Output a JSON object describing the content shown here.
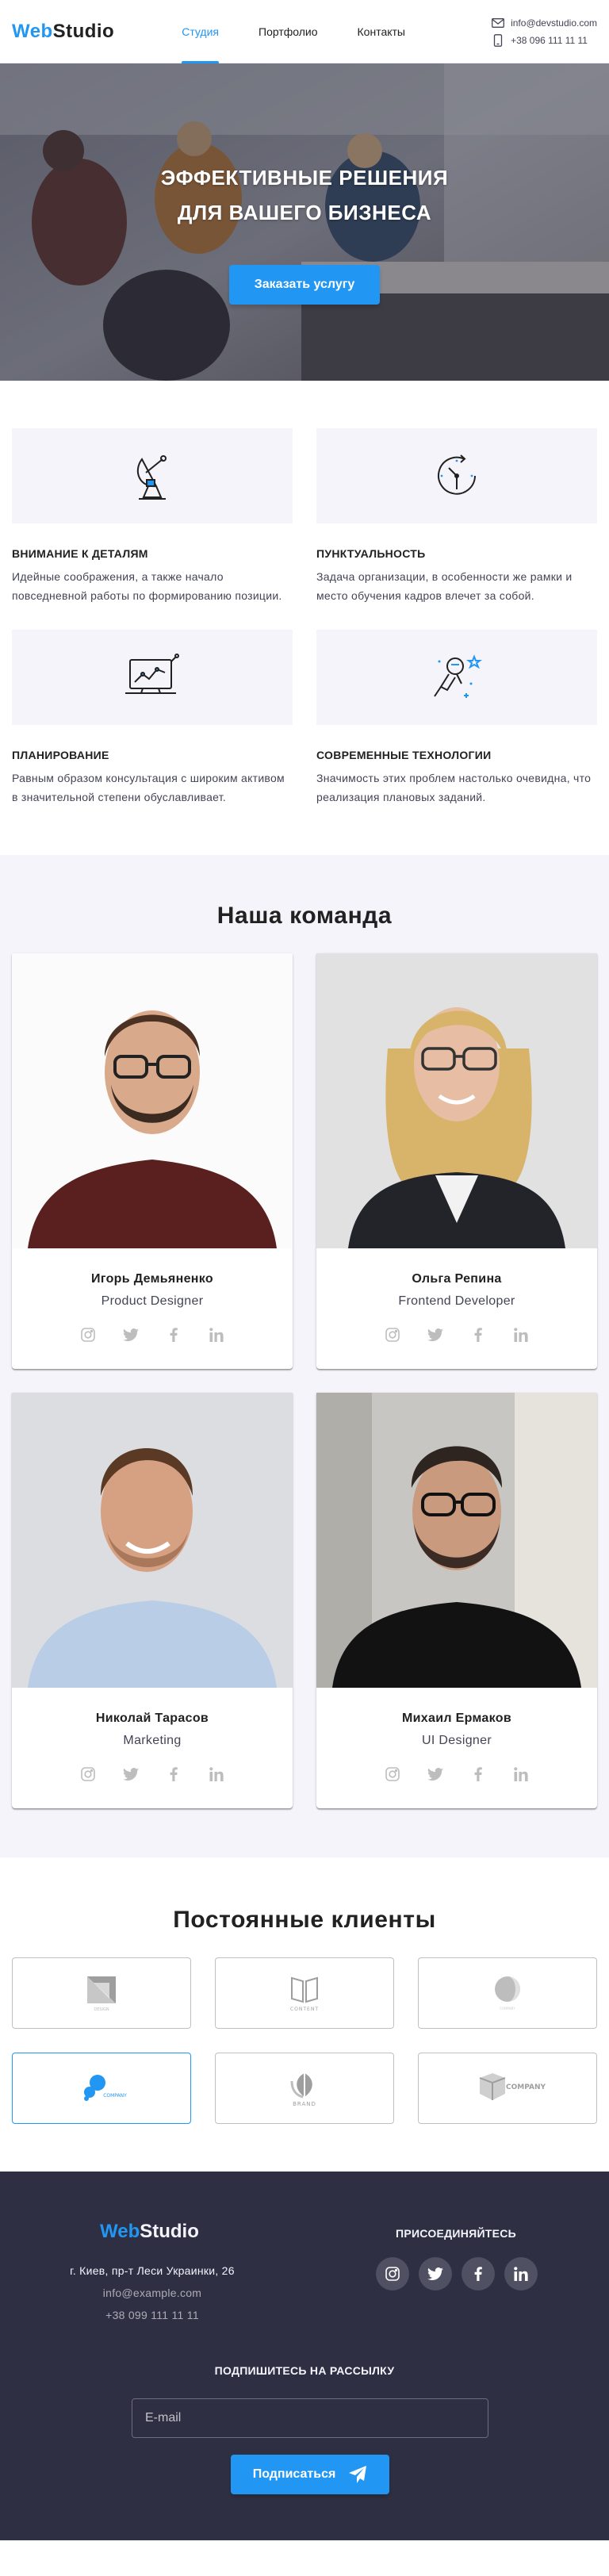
{
  "header": {
    "logo_part1": "Web",
    "logo_part2": "Studio",
    "nav": [
      "Студия",
      "Портфолио",
      "Контакты"
    ],
    "email": "info@devstudio.com",
    "phone": "+38 096 111 11 11"
  },
  "hero": {
    "title_line1": "ЭФФЕКТИВНЫЕ РЕШЕНИЯ",
    "title_line2": "ДЛЯ ВАШЕГО БИЗНЕСА",
    "button": "Заказать услугу"
  },
  "features": [
    {
      "icon": "satellite-dish-icon",
      "title": "ВНИМАНИЕ К ДЕТАЛЯМ",
      "text": "Идейные соображения, а также начало повседневной работы по формированию позиции."
    },
    {
      "icon": "clock-icon",
      "title": "ПУНКТУАЛЬНОСТЬ",
      "text": "Задача организации, в особенности же рамки и место обучения кадров влечет за собой."
    },
    {
      "icon": "chart-monitor-icon",
      "title": "ПЛАНИРОВАНИЕ",
      "text": "Равным образом консультация с широким активом в значительной степени обуславливает."
    },
    {
      "icon": "astronaut-icon",
      "title": "СОВРЕМЕННЫЕ ТЕХНОЛОГИИ",
      "text": "Значимость этих проблем настолько очевидна, что реализация плановых заданий."
    }
  ],
  "team": {
    "title": "Наша команда",
    "members": [
      {
        "name": "Игорь Демьяненко",
        "role": "Product Designer"
      },
      {
        "name": "Ольга Репина",
        "role": "Frontend Developer"
      },
      {
        "name": "Николай Тарасов",
        "role": "Marketing"
      },
      {
        "name": "Михаил Ермаков",
        "role": "UI Designer"
      }
    ]
  },
  "clients": {
    "title": "Постоянные клиенты",
    "logos": [
      "DESIGN",
      "CONTENT",
      "COMPANY",
      "COMPANY",
      "BRAND",
      "COMPANY"
    ],
    "active_index": 3
  },
  "footer": {
    "logo_part1": "Web",
    "logo_part2": "Studio",
    "address": "г. Киев, пр-т Леси Украинки, 26",
    "email": "info@example.com",
    "phone": "+38 099 111 11 11",
    "join_title": "ПРИСОЕДИНЯЙТЕСЬ",
    "subscribe_title": "ПОДПИШИТЕСЬ НА РАССЫЛКУ",
    "email_placeholder": "E-mail",
    "subscribe_button": "Подписаться"
  },
  "colors": {
    "accent": "#2196f3",
    "footer_bg": "#2e2f42",
    "section_bg": "#f5f4fa"
  }
}
